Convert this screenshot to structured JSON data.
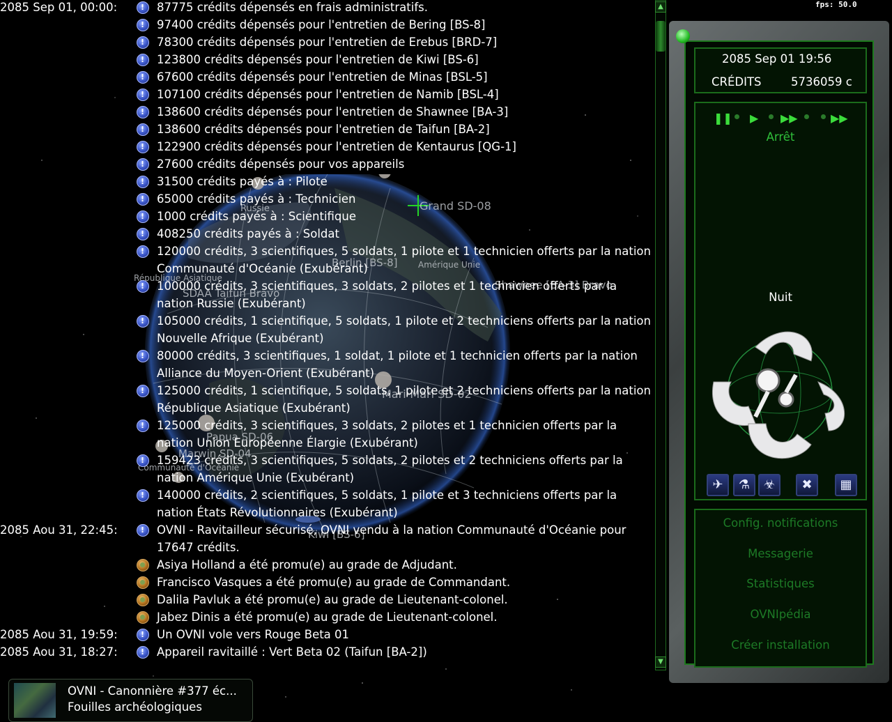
{
  "fps_label": "fps: 50.0",
  "map_labels": {
    "russie": "Russie",
    "sd08": "Grand SD-08",
    "berlin": "Berlin [BS-8]",
    "amerique": "Amérique Unie",
    "rep_asiatique": "République Asiatique",
    "taifun_bravo": "SDAA Taifun Bravo",
    "shawnee": "Shawnee [BA-3] Bravo",
    "mari": "Mari-Mari SD-02",
    "papua": "Papua SD-06",
    "marwin": "Marwin SD-04",
    "oceanie": "Communauté d'Océanie",
    "kiwi": "Kiwi [BS-6]"
  },
  "messages": [
    {
      "date": "2085 Sep 01, 00:00:",
      "icon": "info",
      "text": "87775 crédits dépensés en frais administratifs."
    },
    {
      "date": "",
      "icon": "info",
      "text": "97400 crédits dépensés pour l'entretien de Bering [BS-8]"
    },
    {
      "date": "",
      "icon": "info",
      "text": "78300 crédits dépensés pour l'entretien de Erebus [BRD-7]"
    },
    {
      "date": "",
      "icon": "info",
      "text": "123800 crédits dépensés pour l'entretien de Kiwi [BS-6]"
    },
    {
      "date": "",
      "icon": "info",
      "text": "67600 crédits dépensés pour l'entretien de Minas [BSL-5]"
    },
    {
      "date": "",
      "icon": "info",
      "text": "107100 crédits dépensés pour l'entretien de Namib [BSL-4]"
    },
    {
      "date": "",
      "icon": "info",
      "text": "138600 crédits dépensés pour l'entretien de Shawnee [BA-3]"
    },
    {
      "date": "",
      "icon": "info",
      "text": "138600 crédits dépensés pour l'entretien de Taifun [BA-2]"
    },
    {
      "date": "",
      "icon": "info",
      "text": "122900 crédits dépensés pour l'entretien de Kentaurus [QG-1]"
    },
    {
      "date": "",
      "icon": "info",
      "text": "27600 crédits dépensés pour vos appareils"
    },
    {
      "date": "",
      "icon": "info",
      "text": "31500 crédits payés à : Pilote"
    },
    {
      "date": "",
      "icon": "info",
      "text": "65000 crédits payés à : Technicien"
    },
    {
      "date": "",
      "icon": "info",
      "text": "1000 crédits payés à : Scientifique"
    },
    {
      "date": "",
      "icon": "info",
      "text": "408250 crédits payés à : Soldat"
    },
    {
      "date": "",
      "icon": "info",
      "text": "120000 crédits, 3 scientifiques, 5 soldats, 1 pilote et 1 technicien offerts par la nation Communauté d'Océanie (Exubérant)"
    },
    {
      "date": "",
      "icon": "info",
      "text": "100000 crédits, 3 scientifiques, 3 soldats, 2 pilotes et 1 technicien offerts par la nation Russie (Exubérant)"
    },
    {
      "date": "",
      "icon": "info",
      "text": "105000 crédits, 1 scientifique, 5 soldats, 1 pilote et 2 techniciens offerts par la nation Nouvelle Afrique (Exubérant)"
    },
    {
      "date": "",
      "icon": "info",
      "text": "80000 crédits, 3 scientifiques, 1 soldat, 1 pilote et 1 technicien offerts par la nation Alliance du Moyen-Orient (Exubérant)"
    },
    {
      "date": "",
      "icon": "info",
      "text": "125000 crédits, 1 scientifique, 5 soldats, 1 pilote et 2 techniciens offerts par la nation République Asiatique (Exubérant)"
    },
    {
      "date": "",
      "icon": "info",
      "text": "125000 crédits, 3 scientifiques, 3 soldats, 2 pilotes et 1 technicien offerts par la nation Union Européenne Élargie (Exubérant)"
    },
    {
      "date": "",
      "icon": "info",
      "text": "159423 crédits, 3 scientifiques, 5 soldats, 2 pilotes et 2 techniciens offerts par la nation Amérique Unie (Exubérant)"
    },
    {
      "date": "",
      "icon": "info",
      "text": "140000 crédits, 2 scientifiques, 5 soldats, 1 pilote et 3 techniciens offerts par la nation États Révolutionnaires (Exubérant)"
    },
    {
      "date": "2085 Aou 31, 22:45:",
      "icon": "info",
      "text": "OVNI - Ravitailleur sécurisé, OVNI vendu à la nation Communauté d'Océanie pour 17647 crédits."
    },
    {
      "date": "",
      "icon": "promo",
      "text": "Asiya Holland a été promu(e) au grade de Adjudant."
    },
    {
      "date": "",
      "icon": "promo",
      "text": "Francisco Vasques a été promu(e) au grade de Commandant."
    },
    {
      "date": "",
      "icon": "promo",
      "text": "Dalila Pavluk a été promu(e) au grade de Lieutenant-colonel."
    },
    {
      "date": "",
      "icon": "promo",
      "text": "Jabez Dinis a été promu(e) au grade de Lieutenant-colonel."
    },
    {
      "date": "2085 Aou 31, 19:59:",
      "icon": "info",
      "text": "Un OVNI vole vers Rouge Beta 01"
    },
    {
      "date": "2085 Aou 31, 18:27:",
      "icon": "info",
      "text": "Appareil ravitaillé : Vert Beta 02 (Taifun [BA-2])"
    }
  ],
  "panel": {
    "datetime": "2085 Sep 01 19:56",
    "credits_label": "CRÉDITS",
    "credits_value": "5736059 c",
    "time_state": "Arrêt",
    "daylight": "Nuit",
    "menu": [
      "Config. notifications",
      "Messagerie",
      "Statistiques",
      "OVNIpédia",
      "Créer installation"
    ]
  },
  "notification": {
    "line1": "OVNI - Canonnière #377 éc...",
    "line2": "Fouilles archéologiques"
  }
}
